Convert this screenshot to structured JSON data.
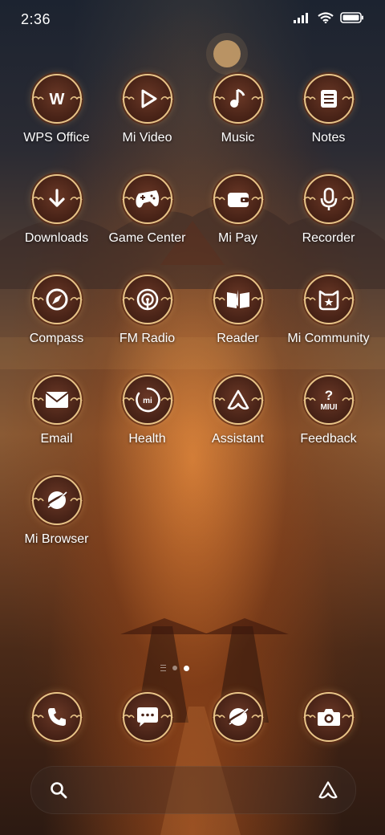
{
  "status_bar": {
    "time": "2:36"
  },
  "apps": [
    {
      "label": "WPS Office",
      "icon": "wps-office-icon"
    },
    {
      "label": "Mi Video",
      "icon": "play-icon"
    },
    {
      "label": "Music",
      "icon": "music-note-icon"
    },
    {
      "label": "Notes",
      "icon": "notes-icon"
    },
    {
      "label": "Downloads",
      "icon": "download-arrow-icon"
    },
    {
      "label": "Game Center",
      "icon": "gamepad-icon"
    },
    {
      "label": "Mi Pay",
      "icon": "wallet-icon"
    },
    {
      "label": "Recorder",
      "icon": "microphone-icon"
    },
    {
      "label": "Compass",
      "icon": "compass-icon"
    },
    {
      "label": "FM Radio",
      "icon": "radio-icon"
    },
    {
      "label": "Reader",
      "icon": "book-icon"
    },
    {
      "label": "Mi Community",
      "icon": "community-icon"
    },
    {
      "label": "Email",
      "icon": "envelope-icon"
    },
    {
      "label": "Health",
      "icon": "health-ring-icon"
    },
    {
      "label": "Assistant",
      "icon": "assistant-icon"
    },
    {
      "label": "Feedback",
      "icon": "feedback-miui-icon"
    },
    {
      "label": "Mi Browser",
      "icon": "browser-icon"
    }
  ],
  "icon_text": {
    "wps": "W",
    "health": "mi",
    "feedback_q": "?",
    "feedback_miui": "MIUI"
  },
  "dock": [
    {
      "icon": "phone-icon"
    },
    {
      "icon": "messages-icon"
    },
    {
      "icon": "browser-icon"
    },
    {
      "icon": "camera-icon"
    }
  ],
  "page_indicator": {
    "current": 2,
    "total": 2
  },
  "colors": {
    "accent_gold": "#e8c488",
    "icon_fill": "#4a2418",
    "glyph": "#ffffff"
  }
}
